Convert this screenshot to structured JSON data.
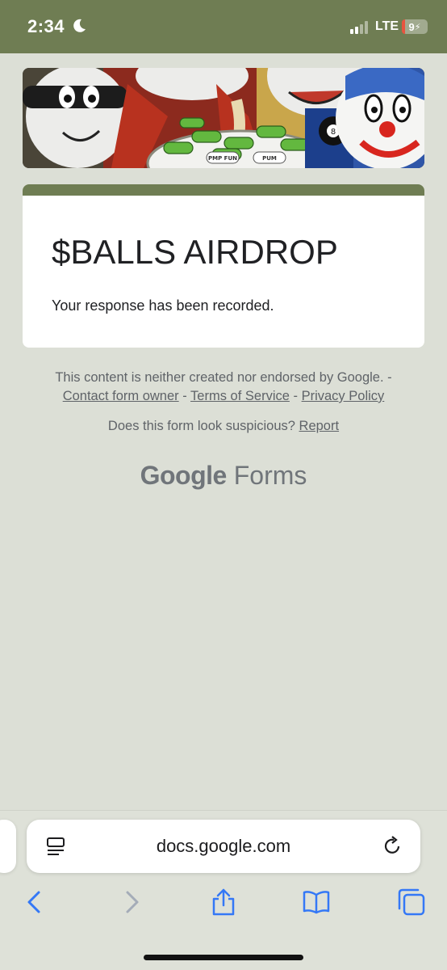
{
  "status_bar": {
    "time": "2:34",
    "network": "LTE",
    "battery": "9",
    "battery_level_percent": 9,
    "icons": [
      "moon-icon",
      "signal-icon",
      "charging-icon"
    ]
  },
  "banner": {
    "description_icons": [
      "masked-ball-character",
      "king-character",
      "pills-bowl",
      "eight-ball-character",
      "clown-character"
    ],
    "pill_labels": [
      "PMP FUN",
      "PUM"
    ]
  },
  "form": {
    "title": "$BALLS AIRDROP",
    "message": "Your response has been recorded.",
    "accent_color": "#6f7d53"
  },
  "footer": {
    "disclaimer": "This content is neither created nor endorsed by Google. -",
    "link_contact": "Contact form owner",
    "sep1": " - ",
    "link_terms": "Terms of Service",
    "sep2": " - ",
    "link_privacy": "Privacy Policy",
    "suspicious": "Does this form look suspicious? ",
    "link_report": "Report",
    "logo_google": "Google",
    "logo_forms": "Forms"
  },
  "browser": {
    "url": "docs.google.com",
    "icons": [
      "reader-icon",
      "reload-icon",
      "back-icon",
      "forward-icon",
      "share-icon",
      "bookmarks-icon",
      "tabs-icon"
    ],
    "accent_color": "#3478f6"
  }
}
